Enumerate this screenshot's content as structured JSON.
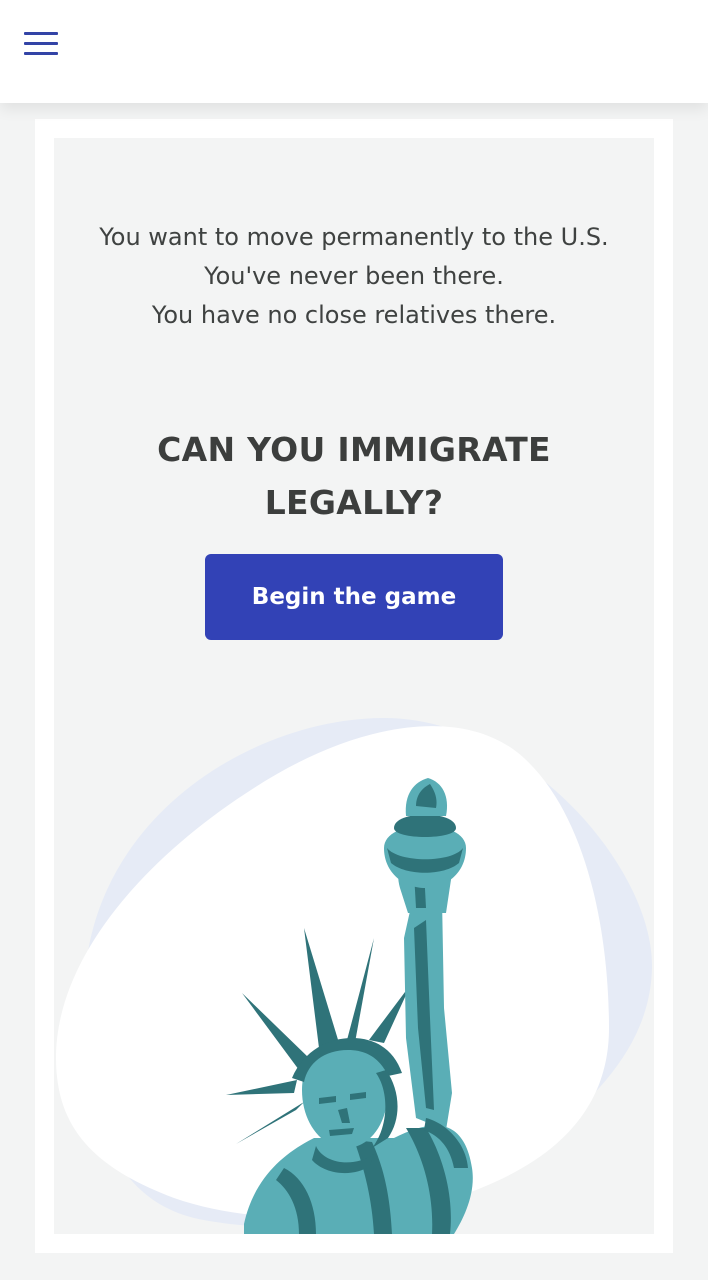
{
  "header": {
    "menu_icon": "hamburger-menu-icon",
    "accent_color": "#3344a6"
  },
  "intro": {
    "line1": "You want to move permanently to the U.S.",
    "line2": "You've never been there.",
    "line3": "You have no close relatives there."
  },
  "question": {
    "text": "CAN YOU IMMIGRATE LEGALLY?"
  },
  "begin_button": {
    "label": "Begin the game",
    "color": "#3242b6"
  },
  "illustration": {
    "subject": "statue-of-liberty-illustration",
    "colors": {
      "teal_light": "#5aaeb6",
      "teal_dark": "#2f7379",
      "blob_back": "#e6ebf6",
      "blob_front": "#ffffff"
    }
  }
}
